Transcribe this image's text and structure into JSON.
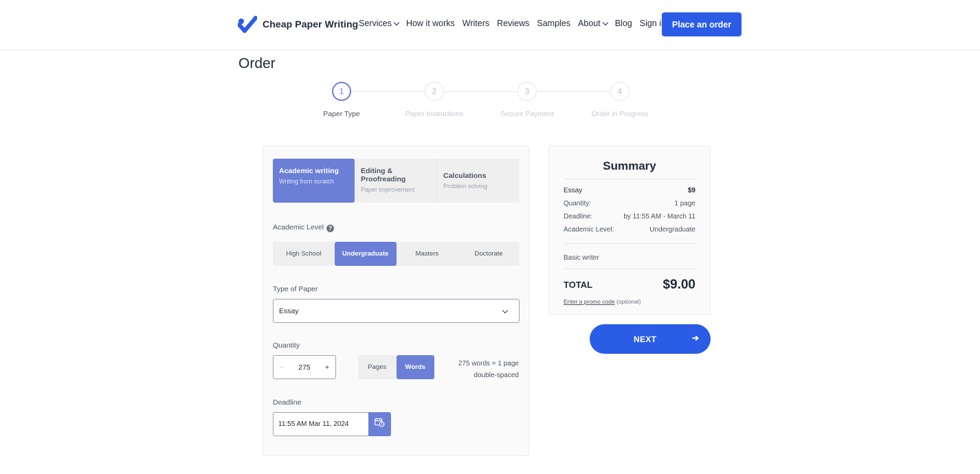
{
  "header": {
    "brand": "Cheap Paper Writing",
    "nav": [
      {
        "label": "Services",
        "dropdown": true
      },
      {
        "label": "How it works",
        "dropdown": false
      },
      {
        "label": "Writers",
        "dropdown": false
      },
      {
        "label": "Reviews",
        "dropdown": false
      },
      {
        "label": "Samples",
        "dropdown": false
      },
      {
        "label": "About",
        "dropdown": true
      },
      {
        "label": "Blog",
        "dropdown": false
      },
      {
        "label": "Sign in",
        "dropdown": false
      }
    ],
    "cta": "Place an order"
  },
  "page_title": "Order",
  "steps": [
    {
      "num": "1",
      "label": "Paper Type",
      "active": true
    },
    {
      "num": "2",
      "label": "Paper Instructions",
      "active": false
    },
    {
      "num": "3",
      "label": "Secure Payment",
      "active": false
    },
    {
      "num": "4",
      "label": "Order in Progress",
      "active": false
    }
  ],
  "form": {
    "service_tabs": [
      {
        "title": "Academic writing",
        "subtitle": "Writing from scratch",
        "active": true
      },
      {
        "title": "Editing & Proofreading",
        "subtitle": "Paper improvement",
        "active": false
      },
      {
        "title": "Calculations",
        "subtitle": "Problem solving",
        "active": false
      }
    ],
    "academic_level": {
      "label": "Academic Level",
      "help_icon": "?",
      "options": [
        "High School",
        "Undergraduate",
        "Masters",
        "Doctorate"
      ],
      "selected": "Undergraduate"
    },
    "paper_type": {
      "label": "Type of Paper",
      "value": "Essay"
    },
    "quantity": {
      "label": "Quantity",
      "minus": "−",
      "plus": "+",
      "value": "275",
      "units": [
        "Pages",
        "Words"
      ],
      "selected_unit": "Words",
      "note_line1": "275 words = 1 page",
      "note_line2": "double-spaced"
    },
    "deadline": {
      "label": "Deadline",
      "value": "11:55 AM Mar 11, 2024",
      "icon": "calendar-clock-icon"
    }
  },
  "summary": {
    "title": "Summary",
    "rows": [
      {
        "key": "Essay",
        "value": "$9"
      },
      {
        "key": "Quantity:",
        "value": "1 page"
      },
      {
        "key": "Deadline:",
        "value": "by 11:55 AM - March 11"
      },
      {
        "key": "Academic Level:",
        "value": "Undergraduate"
      }
    ],
    "writer": "Basic writer",
    "total_label": "TOTAL",
    "total_value": "$9.00",
    "promo_link": "Enter a promo code",
    "promo_note": "(optional)"
  },
  "next_button": {
    "label": "NEXT",
    "arrow": "➔"
  },
  "colors": {
    "primary": "#2b5ce6",
    "accent": "#6b7fd7",
    "text": "#1e2a3b"
  }
}
